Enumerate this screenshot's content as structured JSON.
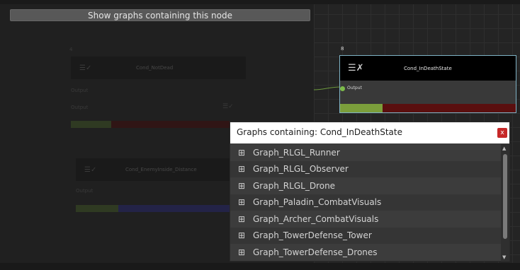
{
  "toolbar": {
    "show_graphs_label": "Show graphs containing this node"
  },
  "background_nodes": [
    {
      "title": "Cond_NotDead",
      "section": "Output",
      "port": "Output"
    },
    {
      "title": "Cond_EnemyInside_Distance",
      "section": "Output"
    }
  ],
  "node": {
    "number": "8",
    "icon": "condition-checklist-icon",
    "title": "Cond_InDeathState",
    "port": "Output",
    "colors": {
      "border": "#7fb3c6",
      "bar_true": "#7b9e3b",
      "bar_false": "#5a0f0f",
      "port": "#7dbb4a"
    }
  },
  "popup": {
    "title": "Graphs containing: Cond_InDeathState",
    "close_label": "x",
    "items": [
      {
        "label": "Graph_RLGL_Runner",
        "icon": "graph-icon"
      },
      {
        "label": "Graph_RLGL_Observer",
        "icon": "graph-icon"
      },
      {
        "label": "Graph_RLGL_Drone",
        "icon": "graph-icon"
      },
      {
        "label": "Graph_Paladin_CombatVisuals",
        "icon": "graph-icon"
      },
      {
        "label": "Graph_Archer_CombatVisuals",
        "icon": "graph-icon"
      },
      {
        "label": "Graph_TowerDefense_Tower",
        "icon": "graph-icon"
      },
      {
        "label": "Graph_TowerDefense_Drones",
        "icon": "graph-icon"
      }
    ]
  }
}
